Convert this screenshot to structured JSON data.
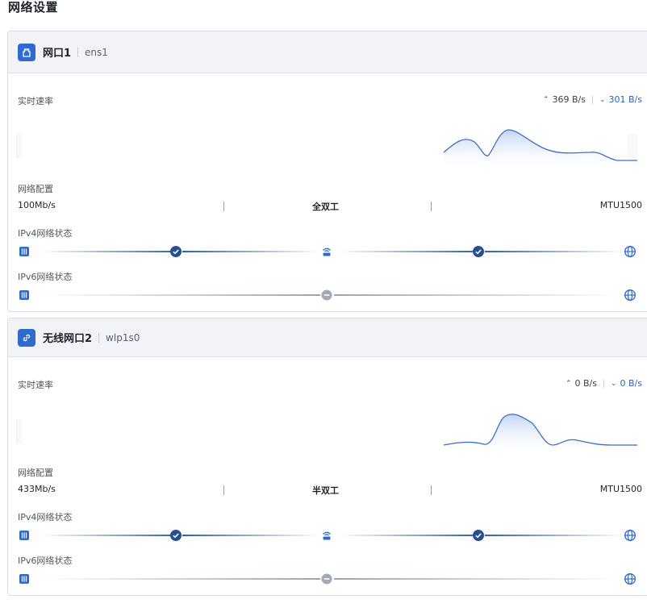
{
  "page": {
    "title": "网络设置"
  },
  "interfaces": [
    {
      "name": "网口1",
      "device": "ens1",
      "icon": "ethernet-port-icon",
      "speed_label": "实时速率",
      "upload": "369 B/s",
      "download": "301 B/s",
      "config_label": "网络配置",
      "link_speed": "100Mb/s",
      "duplex": "全双工",
      "mtu": "MTU1500",
      "ipv4_label": "IPv4网络状态",
      "ipv6_label": "IPv6网络状态",
      "ipv4_state": "connected",
      "ipv6_state": "disconnected"
    },
    {
      "name": "无线网口2",
      "device": "wlp1s0",
      "icon": "link-icon",
      "speed_label": "实时速率",
      "upload": "0 B/s",
      "download": "0 B/s",
      "config_label": "网络配置",
      "link_speed": "433Mb/s",
      "duplex": "半双工",
      "mtu": "MTU1500",
      "ipv4_label": "IPv4网络状态",
      "ipv6_label": "IPv6网络状态",
      "ipv4_state": "connected",
      "ipv6_state": "disconnected"
    }
  ],
  "colors": {
    "accent": "#2f6ad0",
    "line_active": "#2f5fa8",
    "line_inactive": "#9da3b4"
  }
}
